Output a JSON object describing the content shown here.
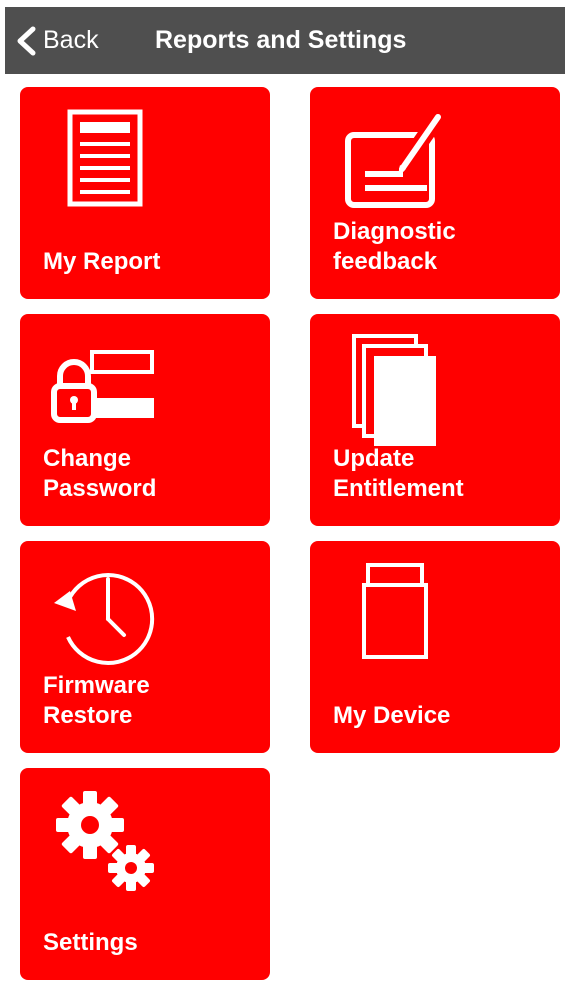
{
  "header": {
    "back_label": "Back",
    "title": "Reports and Settings",
    "background_color": "#4f4f4f"
  },
  "tiles": [
    {
      "label": "My Report",
      "icon": "report-document-icon"
    },
    {
      "label": "Diagnostic\nfeedback",
      "icon": "edit-feedback-icon"
    },
    {
      "label": "Change\nPassword",
      "icon": "lock-password-icon"
    },
    {
      "label": "Update\nEntitlement",
      "icon": "stacked-pages-icon"
    },
    {
      "label": "Firmware\nRestore",
      "icon": "clock-restore-icon"
    },
    {
      "label": "My Device",
      "icon": "device-icon"
    },
    {
      "label": "Settings",
      "icon": "gears-icon"
    }
  ],
  "colors": {
    "tile": "#ff0000",
    "tile_text": "#ffffff",
    "background": "#ffffff"
  }
}
